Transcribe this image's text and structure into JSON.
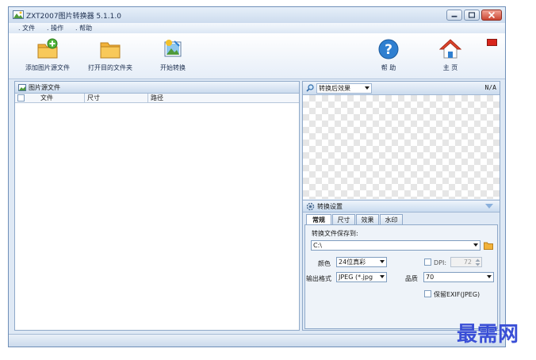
{
  "window": {
    "title": "ZXT2007图片转换器 5.1.1.0"
  },
  "menu": {
    "items": [
      "文件",
      "操作",
      "帮助"
    ]
  },
  "toolbar": {
    "add_source": "添加图片源文件",
    "open_dest": "打开目的文件夹",
    "start_convert": "开始转换",
    "help": "帮 助",
    "home": "主 页"
  },
  "source_panel": {
    "title": "图片源文件",
    "columns": [
      "文件",
      "尺寸",
      "路径"
    ]
  },
  "preview": {
    "dropdown": "转换后效果",
    "size": "N/A"
  },
  "settings": {
    "title": "转换设置",
    "tabs": [
      "常规",
      "尺寸",
      "效果",
      "水印"
    ],
    "save_label": "转换文件保存到:",
    "save_path": "C:\\",
    "color_label": "颜色",
    "color_value": "24位真彩",
    "dpi_label": "DPI:",
    "dpi_value": "72",
    "format_label": "输出格式",
    "format_value": "JPEG (*.jpg",
    "quality_label": "品质",
    "quality_value": "70",
    "exif_label": "保留EXIF(JPEG)"
  },
  "watermark_text": "最需网",
  "colors": {
    "accent": "#2f7fd0",
    "folder": "#f2b23a",
    "flag": "#d8251c",
    "home_roof": "#e0452c"
  }
}
